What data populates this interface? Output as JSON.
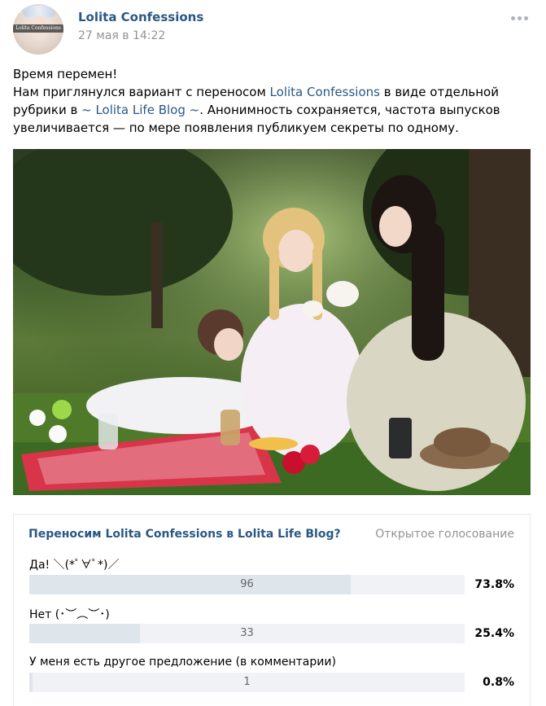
{
  "post": {
    "author": "Lolita Confessions",
    "date": "27 мая в 14:22",
    "avatar_text": "Lolita Confessions"
  },
  "text": {
    "line1": "Время перемен!",
    "line2_pre": "Нам приглянулся вариант с переносом ",
    "link1": "Lolita Confessions",
    "line2_post": " в виде отдельной",
    "line3_pre": "рубрики в ",
    "link2": "~ Lolita Life Blog ~",
    "line3_post": ". Анонимность сохраняется, частота выпусков",
    "line4": "увеличивается — по мере появления публикуем секреты по одному."
  },
  "poll": {
    "title": "Переносим Lolita Confessions в Lolita Life Blog?",
    "type": "Открытое голосование",
    "options": [
      {
        "label": "Да! ＼(*ﾟ∀ﾟ*)／",
        "count": "96",
        "percent": "73.8%",
        "fraction": 0.738
      },
      {
        "label": "Нет (･︶︵︶･)",
        "count": "33",
        "percent": "25.4%",
        "fraction": 0.254
      },
      {
        "label": "У меня есть другое предложение (в комментарии)",
        "count": "1",
        "percent": "0.8%",
        "fraction": 0.008
      }
    ]
  },
  "colors": {
    "link": "#2a5885",
    "muted": "#939393",
    "bar_track": "#f0f2f5",
    "bar_fill": "#dee5eb"
  }
}
